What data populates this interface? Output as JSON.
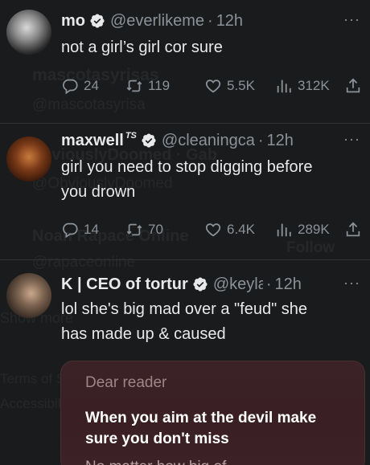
{
  "colors": {
    "background": "#1a1b1d",
    "text_primary": "#e7e9ea",
    "text_secondary": "#8b9298",
    "verified_badge": "#ffffff",
    "card_background": "#3a2226"
  },
  "ghost_text": {
    "g1": "mascotasyrisas",
    "g2": "@mascotasyrisa",
    "g3": "obviouslyDoomed · Gab",
    "g4": "@ObviouslyDoomed",
    "g5": "Noah Rapace Online",
    "g6": "@rapaceonline",
    "g7": "Follow",
    "g8": "Show more",
    "g9": "Terms of Se",
    "g10": "Accessibilit"
  },
  "tweets": [
    {
      "name": "mo",
      "name_suffix": "",
      "handle": "@everlikeme",
      "time": "12h",
      "text": "not a girl’s girl cor sure",
      "replies": "24",
      "retweets": "119",
      "likes": "5.5K",
      "views": "312K",
      "avatar": "avatar-icon"
    },
    {
      "name": "maxwell",
      "name_suffix": "TS",
      "handle": "@cleaningca",
      "time": "12h",
      "text_line1": "girl you need to stop digging before",
      "text_line2": "you drown",
      "replies": "14",
      "retweets": "70",
      "likes": "6.4K",
      "views": "289K",
      "avatar": "avatar-icon"
    },
    {
      "name": "K | CEO of tortur",
      "handle": "@keyla",
      "time": "12h",
      "text_line1": "lol she's big mad over a \"feud\" she",
      "text_line2": "has made up & caused",
      "avatar": "avatar-icon"
    }
  ],
  "dot": "·",
  "more": "···",
  "card": {
    "kicker": "Dear reader",
    "message": "When you aim at the devil make sure you don't miss",
    "cut_line": "No matter how big of"
  }
}
